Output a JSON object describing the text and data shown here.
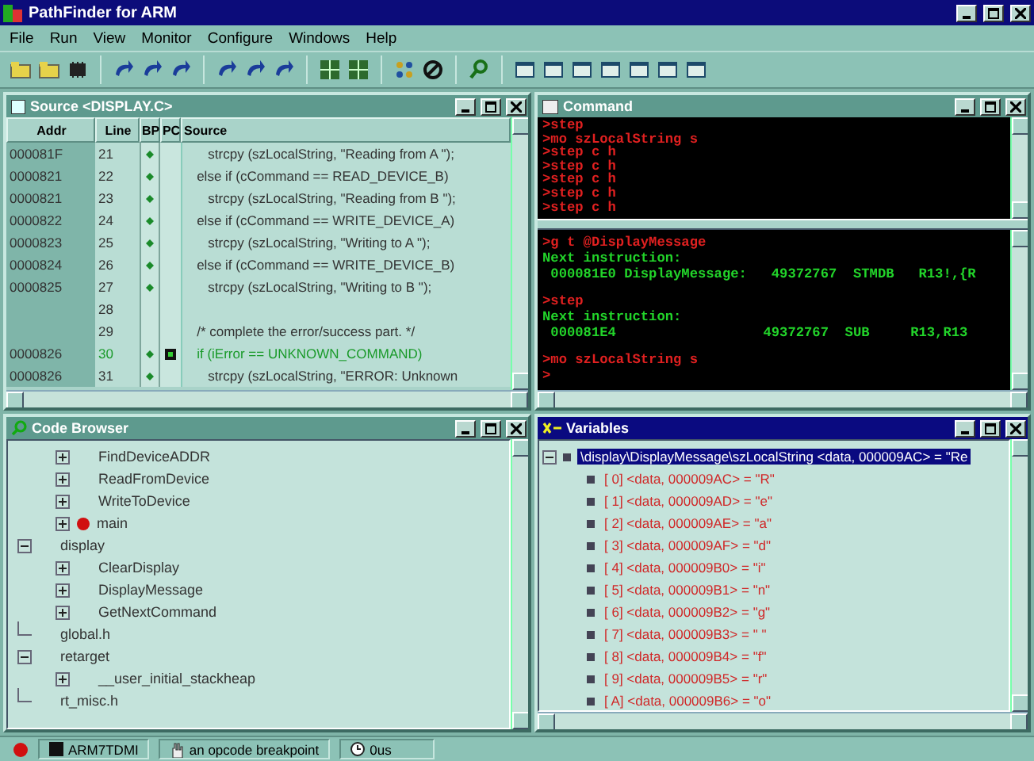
{
  "window": {
    "title": "PathFinder for ARM"
  },
  "menu": [
    "File",
    "Run",
    "View",
    "Monitor",
    "Configure",
    "Windows",
    "Help"
  ],
  "source": {
    "title": "Source <DISPLAY.C>",
    "active": false,
    "columns": [
      "Addr",
      "Line",
      "BP",
      "PC",
      "Source"
    ],
    "rows": [
      {
        "addr": "000081F",
        "line": "21",
        "bp": true,
        "pc": false,
        "current": false,
        "code": "      strcpy (szLocalString, \"Reading from A \");"
      },
      {
        "addr": "0000821",
        "line": "22",
        "bp": true,
        "pc": false,
        "current": false,
        "code": "   else if (cCommand == READ_DEVICE_B)"
      },
      {
        "addr": "0000821",
        "line": "23",
        "bp": true,
        "pc": false,
        "current": false,
        "code": "      strcpy (szLocalString, \"Reading from B \");"
      },
      {
        "addr": "0000822",
        "line": "24",
        "bp": true,
        "pc": false,
        "current": false,
        "code": "   else if (cCommand == WRITE_DEVICE_A)"
      },
      {
        "addr": "0000823",
        "line": "25",
        "bp": true,
        "pc": false,
        "current": false,
        "code": "      strcpy (szLocalString, \"Writing to A \");"
      },
      {
        "addr": "0000824",
        "line": "26",
        "bp": true,
        "pc": false,
        "current": false,
        "code": "   else if (cCommand == WRITE_DEVICE_B)"
      },
      {
        "addr": "0000825",
        "line": "27",
        "bp": true,
        "pc": false,
        "current": false,
        "code": "      strcpy (szLocalString, \"Writing to B \");"
      },
      {
        "line": "28",
        "bp": false,
        "pc": false,
        "current": false
      },
      {
        "line": "29",
        "bp": false,
        "pc": false,
        "current": false,
        "code": "   /* complete the error/success part. */"
      },
      {
        "addr": "0000826",
        "line": "30",
        "bp": true,
        "pc": true,
        "current": true,
        "code": "   if (iError == UNKNOWN_COMMAND)"
      },
      {
        "addr": "0000826",
        "line": "31",
        "bp": true,
        "pc": false,
        "current": false,
        "code": "      strcpy (szLocalString, \"ERROR: Unknown"
      }
    ]
  },
  "command": {
    "title": "Command",
    "active": false,
    "history": [
      ">step",
      ">mo szLocalString s",
      ">step c h",
      ">step c h",
      ">step c h",
      ">step c h",
      ">step c h"
    ],
    "log": [
      {
        "command": ">g t @DisplayMessage",
        "output": [
          "Next instruction:",
          " 000081E0 DisplayMessage:   49372767  STMDB   R13!,{R"
        ]
      },
      {
        "command": ">step",
        "output": [
          "Next instruction:",
          " 000081E4                  49372767  SUB     R13,R13"
        ]
      },
      {
        "command": ">mo szLocalString s"
      }
    ],
    "prompt": ">"
  },
  "code_browser": {
    "title": "Code Browser",
    "active": false,
    "tree": [
      {
        "children": [
          {
            "label": "FindDeviceADDR",
            "expanded": false,
            "breakpoint": false
          },
          {
            "label": "ReadFromDevice",
            "expanded": false,
            "breakpoint": false
          },
          {
            "label": "WriteToDevice",
            "expanded": false,
            "breakpoint": false
          },
          {
            "label": "main",
            "expanded": false,
            "breakpoint": true
          }
        ]
      },
      {
        "label": "display",
        "expanded": true,
        "children": [
          {
            "label": "ClearDisplay",
            "expanded": false,
            "breakpoint": false
          },
          {
            "label": "DisplayMessage",
            "expanded": false,
            "breakpoint": false
          },
          {
            "label": "GetNextCommand",
            "expanded": false,
            "breakpoint": false
          }
        ]
      },
      {
        "label": "global.h"
      },
      {
        "label": "retarget",
        "expanded": true,
        "children": [
          {
            "label": "__user_initial_stackheap",
            "expanded": false,
            "breakpoint": false
          }
        ]
      },
      {
        "label": "rt_misc.h"
      }
    ]
  },
  "variables": {
    "title": "Variables",
    "active": true,
    "root": {
      "label": "\\display\\DisplayMessage\\szLocalString <data, 000009AC> = \"Re",
      "expanded": true,
      "selected": true,
      "children": [
        {
          "label": "[ 0] <data, 000009AC> = \"R\"",
          "selected": false
        },
        {
          "label": "[ 1] <data, 000009AD> = \"e\"",
          "selected": false
        },
        {
          "label": "[ 2] <data, 000009AE> = \"a\"",
          "selected": false
        },
        {
          "label": "[ 3] <data, 000009AF> = \"d\"",
          "selected": false
        },
        {
          "label": "[ 4] <data, 000009B0> = \"i\"",
          "selected": false
        },
        {
          "label": "[ 5] <data, 000009B1> = \"n\"",
          "selected": false
        },
        {
          "label": "[ 6] <data, 000009B2> = \"g\"",
          "selected": false
        },
        {
          "label": "[ 7] <data, 000009B3> = \" \"",
          "selected": false
        },
        {
          "label": "[ 8] <data, 000009B4> = \"f\"",
          "selected": false
        },
        {
          "label": "[ 9] <data, 000009B5> = \"r\"",
          "selected": false
        },
        {
          "label": "[ A] <data, 000009B6> = \"o\"",
          "selected": false
        }
      ]
    }
  },
  "status_bar": {
    "processor": "ARM7TDMI",
    "breakpoint": "an opcode breakpoint",
    "time": "0us"
  }
}
